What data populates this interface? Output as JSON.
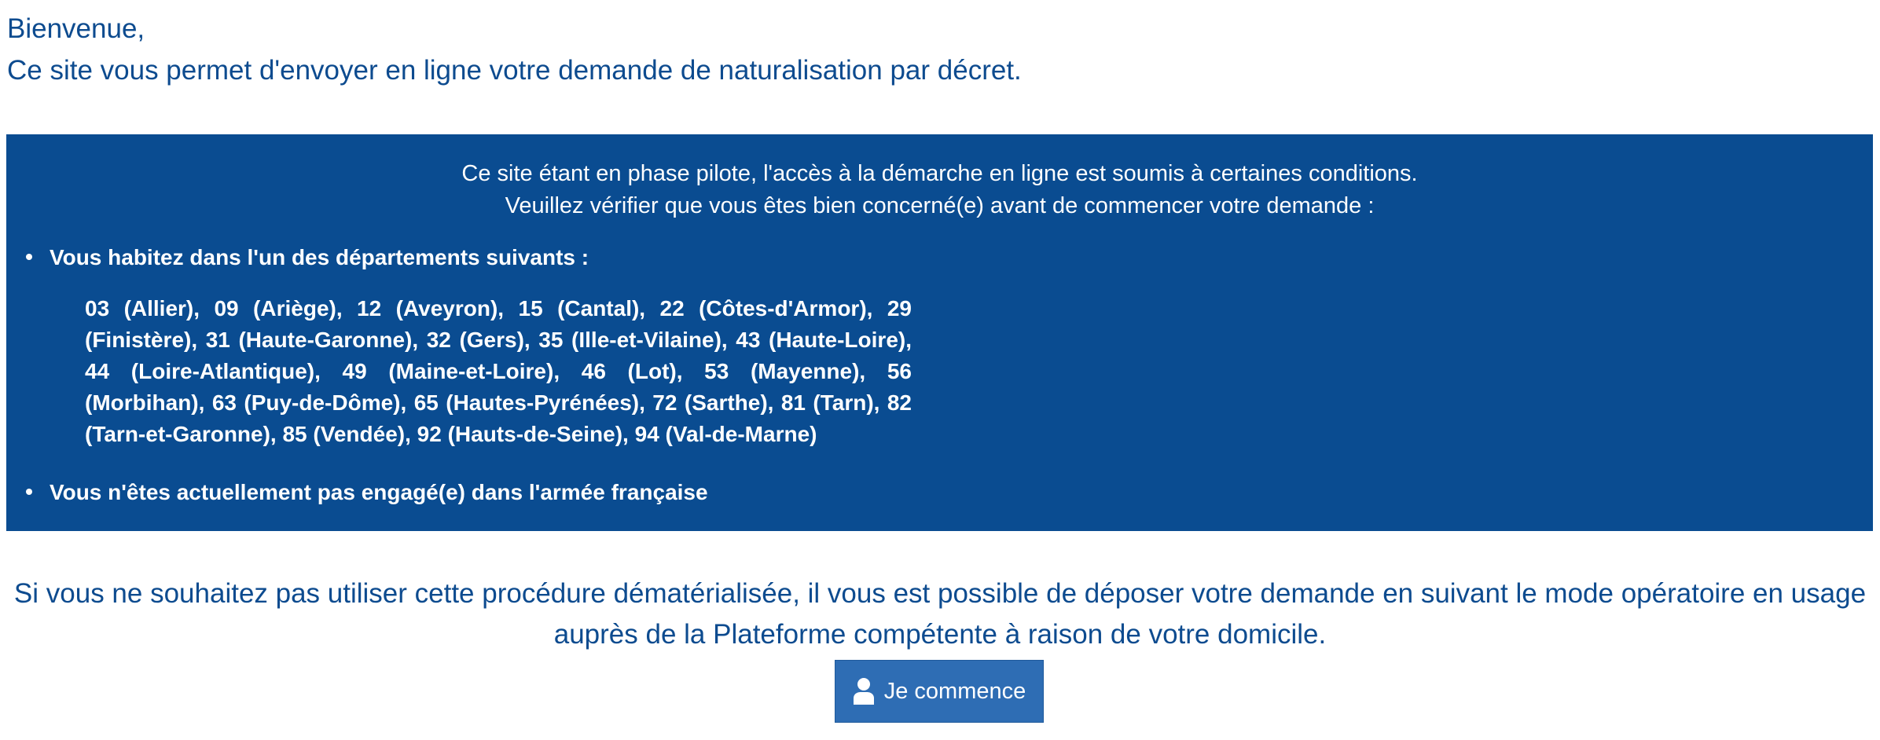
{
  "header": {
    "greeting": "Bienvenue,",
    "intro": "Ce site vous permet d'envoyer en ligne votre demande de naturalisation par décret."
  },
  "panel": {
    "line1": "Ce site étant en phase pilote, l'accès à la démarche en ligne est soumis à certaines conditions.",
    "line2": "Veuillez vérifier que vous êtes bien concerné(e) avant de commencer votre demande :",
    "condition1": "Vous habitez dans l'un des départements suivants :",
    "departments": "03 (Allier), 09 (Ariège), 12 (Aveyron), 15 (Cantal), 22 (Côtes-d'Armor), 29 (Finistère), 31 (Haute-Garonne), 32 (Gers), 35 (Ille-et-Vilaine), 43 (Haute-Loire), 44 (Loire-Atlantique), 49 (Maine-et-Loire), 46 (Lot), 53 (Mayenne), 56 (Morbihan), 63 (Puy-de-Dôme), 65 (Hautes-Pyrénées), 72 (Sarthe), 81 (Tarn), 82 (Tarn-et-Garonne), 85 (Vendée), 92 (Hauts-de-Seine), 94 (Val-de-Marne)",
    "condition2": "Vous n'êtes actuellement pas engagé(e) dans l'armée française"
  },
  "alternative": {
    "text": "Si vous ne souhaitez pas utiliser cette procédure dématérialisée, il vous est possible de déposer votre demande en suivant le mode opératoire en usage auprès de la Plateforme compétente à raison de votre domicile."
  },
  "start_button": {
    "icon": "user-icon",
    "label": "Je commence"
  },
  "colors": {
    "primary_blue": "#0a4c91",
    "button_blue": "#2e6db4",
    "text_white": "#ffffff"
  }
}
